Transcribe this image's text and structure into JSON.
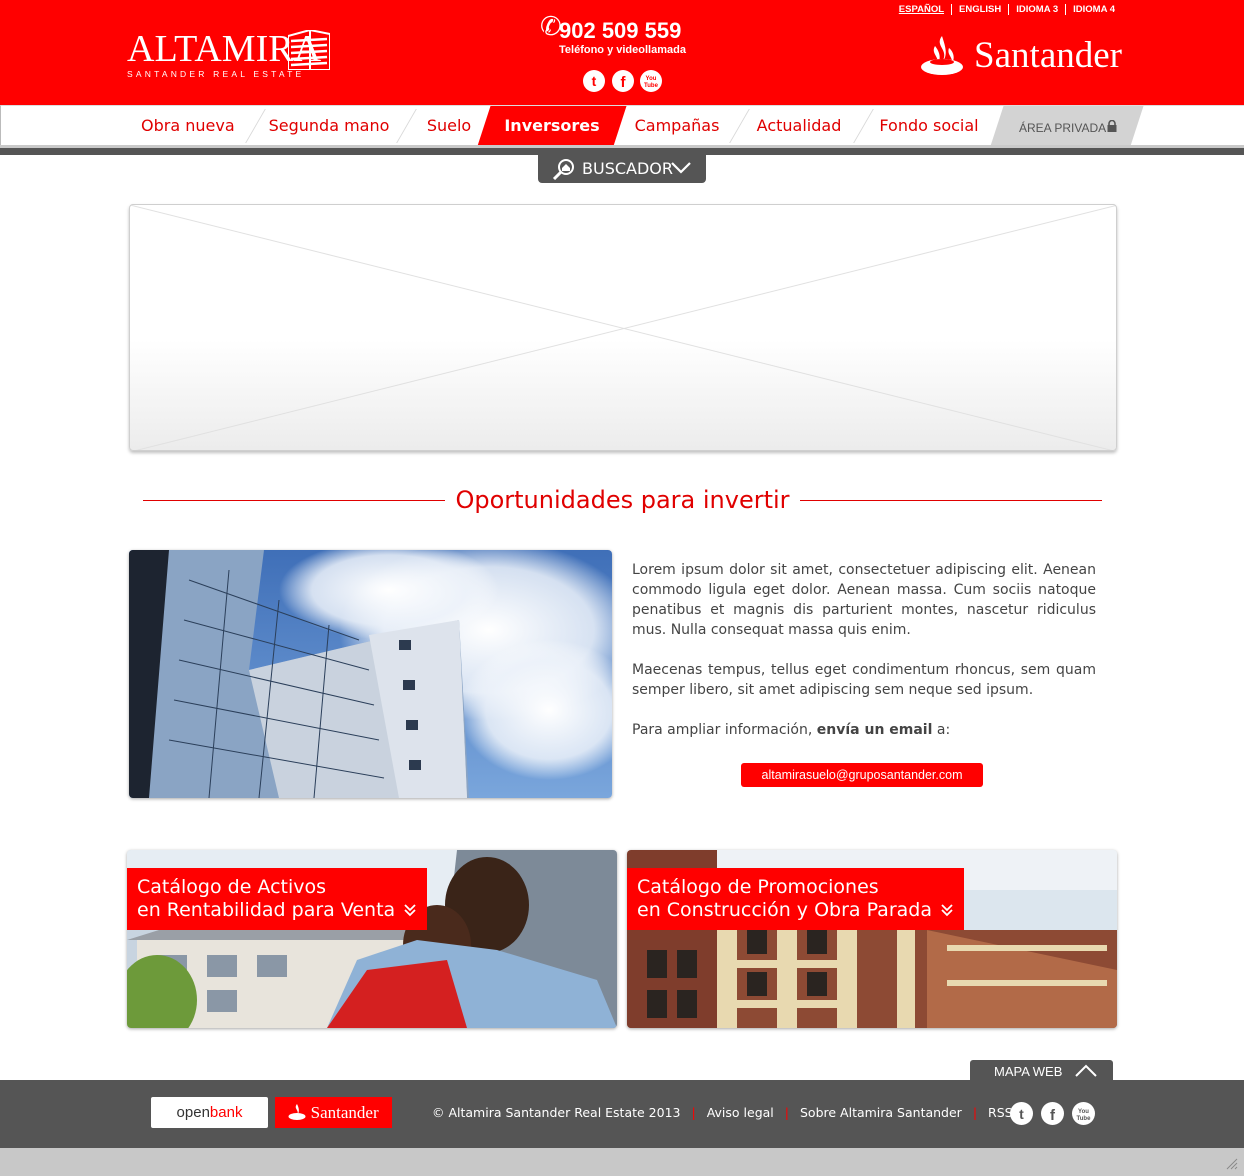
{
  "header": {
    "brand_word": "ALTAMIRA",
    "brand_sub": "SANTANDER REAL ESTATE",
    "phone_number": "902 509 559",
    "phone_caption": "Teléfono y videollamada",
    "languages": [
      "ESPAÑOL",
      "ENGLISH",
      "IDIOMA 3",
      "IDIOMA 4"
    ],
    "bank_logo": "Santander",
    "social": [
      "twitter-icon",
      "facebook-icon",
      "youtube-icon"
    ]
  },
  "nav": {
    "items": [
      "Obra nueva",
      "Segunda mano",
      "Suelo",
      "Inversores",
      "Campañas",
      "Actualidad",
      "Fondo social"
    ],
    "active": "Inversores",
    "private_area": "ÁREA PRIVADA"
  },
  "search": {
    "label": "BUSCADOR"
  },
  "main": {
    "section_title": "Oportunidades para invertir",
    "paragraph_1": "Lorem ipsum dolor sit amet, consectetuer adipiscing elit. Aenean commodo ligula eget dolor. Aenean massa. Cum sociis natoque penatibus et magnis dis parturient montes, nascetur ridiculus mus. Nulla consequat massa quis enim.",
    "paragraph_2": "Maecenas tempus, tellus eget condimentum rhoncus, sem quam semper libero, sit amet adipiscing sem neque sed ipsum.",
    "contact_prefix": "Para ampliar información, ",
    "contact_bold": "envía un email",
    "contact_suffix": " a:",
    "email": "altamirasuelo@gruposantander.com"
  },
  "cards": [
    {
      "line1": "Catálogo de Activos",
      "line2": "en Rentabilidad para Venta"
    },
    {
      "line1": "Catálogo de Promociones",
      "line2": "en Construcción y Obra Parada"
    }
  ],
  "footer": {
    "mapa_web": "MAPA WEB",
    "openbank_a": "open",
    "openbank_b": "bank",
    "santander": "Santander",
    "copyright": "© Altamira Santander Real Estate 2013",
    "links": [
      "Aviso legal",
      "Sobre Altamira Santander",
      "RSS"
    ],
    "youtube_label": "You Tube"
  },
  "colors": {
    "brand_red": "#ff0000",
    "dark_gray": "#555555",
    "light_gray": "#c8c8c8"
  }
}
